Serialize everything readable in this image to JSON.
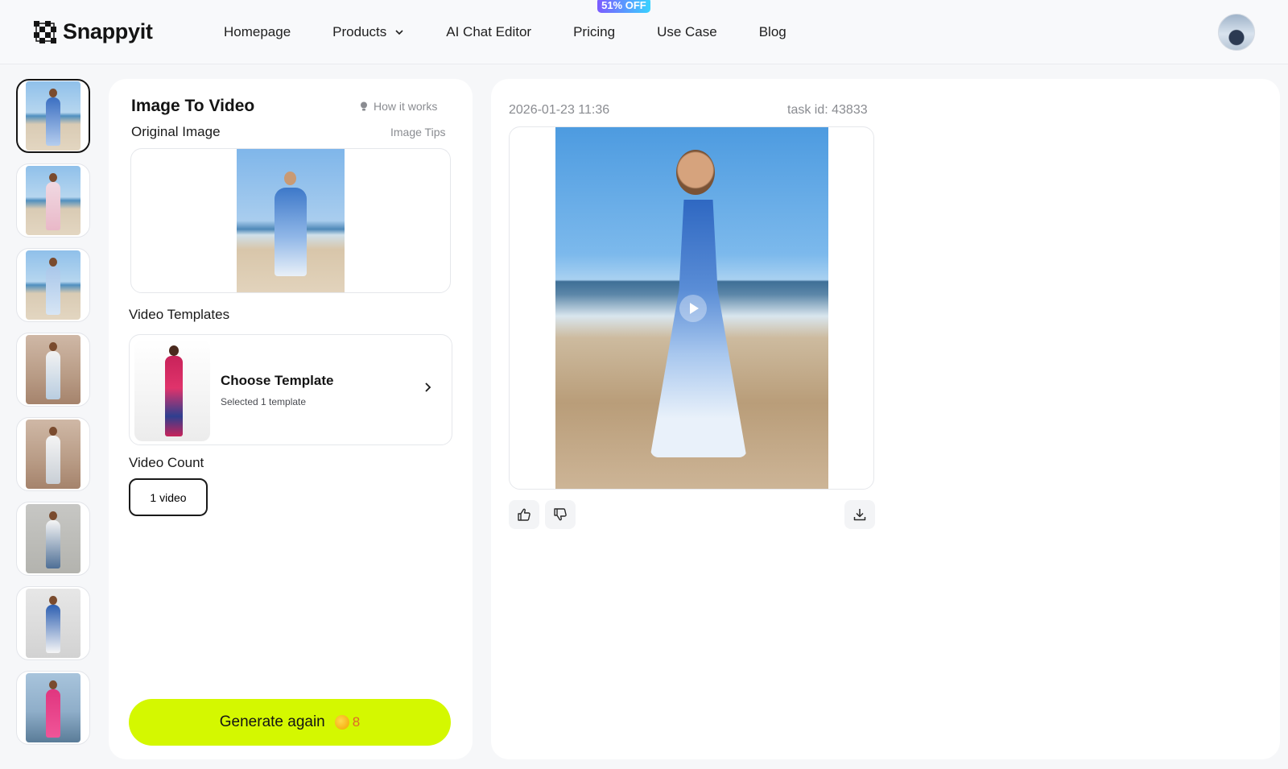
{
  "brand": {
    "name": "Snappyit"
  },
  "nav": {
    "items": [
      {
        "label": "Homepage"
      },
      {
        "label": "Products"
      },
      {
        "label": "AI Chat Editor"
      },
      {
        "label": "Pricing",
        "badge": "51% OFF"
      },
      {
        "label": "Use Case"
      },
      {
        "label": "Blog"
      }
    ]
  },
  "panel": {
    "title": "Image To Video",
    "how_it_works": "How it works",
    "original_label": "Original Image",
    "image_tips": "Image Tips",
    "templates_label": "Video Templates",
    "template_title": "Choose Template",
    "template_sub": "Selected 1 template",
    "count_label": "Video Count",
    "count_value": "1 video",
    "generate_label": "Generate again",
    "generate_cost": "8"
  },
  "result": {
    "timestamp": "2026-01-23 11:36",
    "task_id": "task id: 43833"
  },
  "colors": {
    "accent": "#d4f800",
    "badge_gradient_start": "#7c5cff",
    "badge_gradient_end": "#38d2ff",
    "cost": "#e0682a"
  },
  "icons": {
    "logo": "checker-logo-icon",
    "products_chevron": "chevron-down-icon",
    "how": "lightbulb-icon",
    "template_arrow": "chevron-right-icon",
    "coin": "coin-icon",
    "like": "thumbs-up-icon",
    "dislike": "thumbs-down-icon",
    "download": "download-icon"
  }
}
